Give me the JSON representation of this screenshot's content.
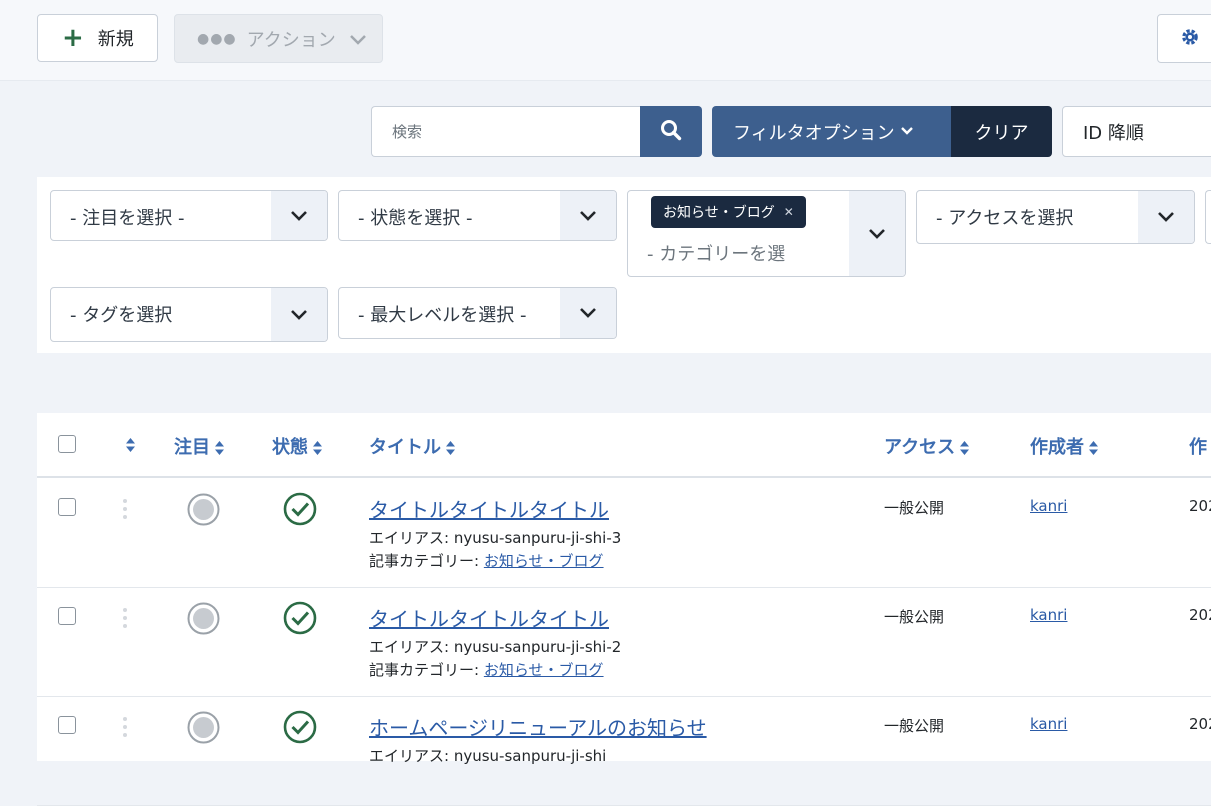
{
  "toolbar": {
    "new_label": "新規",
    "actions_label": "アクション"
  },
  "search": {
    "placeholder": "検索",
    "filter_options_label": "フィルタオプション",
    "clear_label": "クリア",
    "sort_value": "ID 降順"
  },
  "filters": {
    "featured": "- 注目を選択 -",
    "status": "- 状態を選択 -",
    "category_chip": "お知らせ・ブログ",
    "category_placeholder": "- カテゴリーを選",
    "access": "- アクセスを選択",
    "tag": "- タグを選択",
    "max_level": "- 最大レベルを選択 -"
  },
  "table": {
    "headers": {
      "featured": "注目",
      "status": "状態",
      "title": "タイトル",
      "access": "アクセス",
      "author": "作成者",
      "created_partial": "作"
    },
    "rows": [
      {
        "title": "タイトルタイトルタイトル",
        "alias_label": "エイリアス:",
        "alias": "nyusu-sanpuru-ji-shi-3",
        "category_label": "記事カテゴリー:",
        "category": "お知らせ・ブログ",
        "access": "一般公開",
        "author": "kanri",
        "date_partial": "202"
      },
      {
        "title": "タイトルタイトルタイトル",
        "alias_label": "エイリアス:",
        "alias": "nyusu-sanpuru-ji-shi-2",
        "category_label": "記事カテゴリー:",
        "category": "お知らせ・ブログ",
        "access": "一般公開",
        "author": "kanri",
        "date_partial": "202"
      },
      {
        "title": "ホームページリニューアルのお知らせ",
        "alias_label": "エイリアス:",
        "alias": "nyusu-sanpuru-ji-shi",
        "access": "一般公開",
        "author": "kanri",
        "date_partial": "202"
      }
    ]
  },
  "colors": {
    "primary": "#3d5f8e",
    "dark": "#1b2a40",
    "link": "#2a5aa6",
    "published_green": "#2b6b45"
  }
}
